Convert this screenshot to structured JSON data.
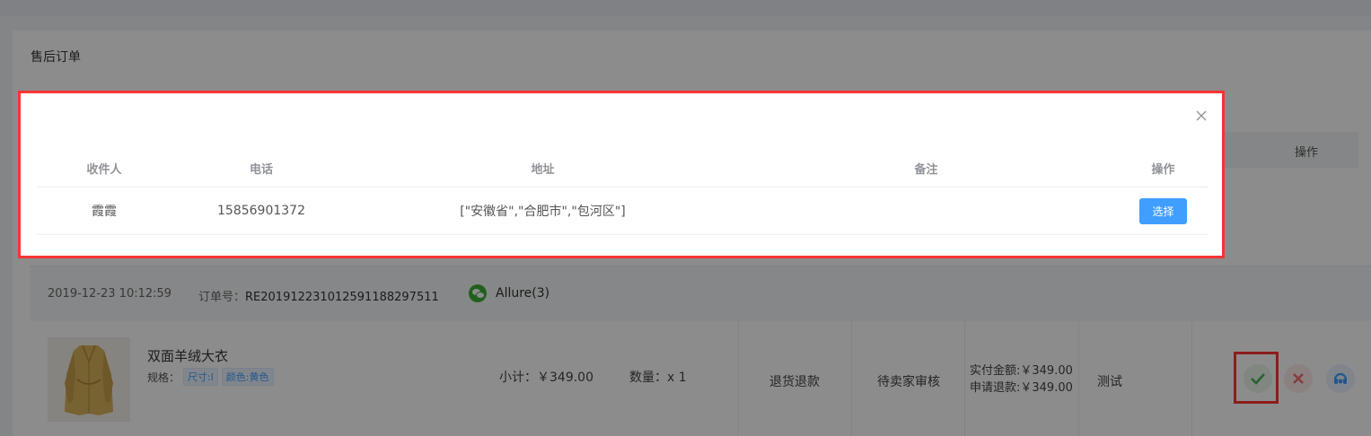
{
  "page": {
    "title": "售后订单",
    "list_header_action": "操作"
  },
  "order": {
    "time": "2019-12-23 10:12:59",
    "order_no_label": "订单号：",
    "order_no": "RE20191223101259118829751​1",
    "user": "Allure(3)",
    "product_name": "双面羊绒大衣",
    "spec_label": "规格：",
    "spec_tags": [
      "尺寸:l",
      "颜色:黄色"
    ],
    "subtotal": "小计：￥349.00",
    "quantity": "数量：x 1",
    "type": "退货退款",
    "status": "待卖家审核",
    "paid_amount": "实付金额:￥349.00",
    "refund_amount": "申请退款:￥349.00",
    "remark": "测试"
  },
  "modal": {
    "columns": [
      "收件人",
      "电话",
      "地址",
      "备注",
      "操作"
    ],
    "rows": [
      {
        "recipient": "霞霞",
        "phone": "15856901372",
        "address": "[\"安徽省\",\"合肥市\",\"包河区\"]",
        "note": "",
        "action_label": "选择"
      }
    ]
  },
  "colors": {
    "accent": "#409eff",
    "highlight": "#ff3333",
    "approve": "#4caf50",
    "reject": "#f56c6c"
  },
  "icons": {
    "close": "close-icon",
    "approve": "check-icon",
    "reject": "x-icon",
    "service": "customer-service-icon",
    "wechat": "wechat-icon"
  }
}
